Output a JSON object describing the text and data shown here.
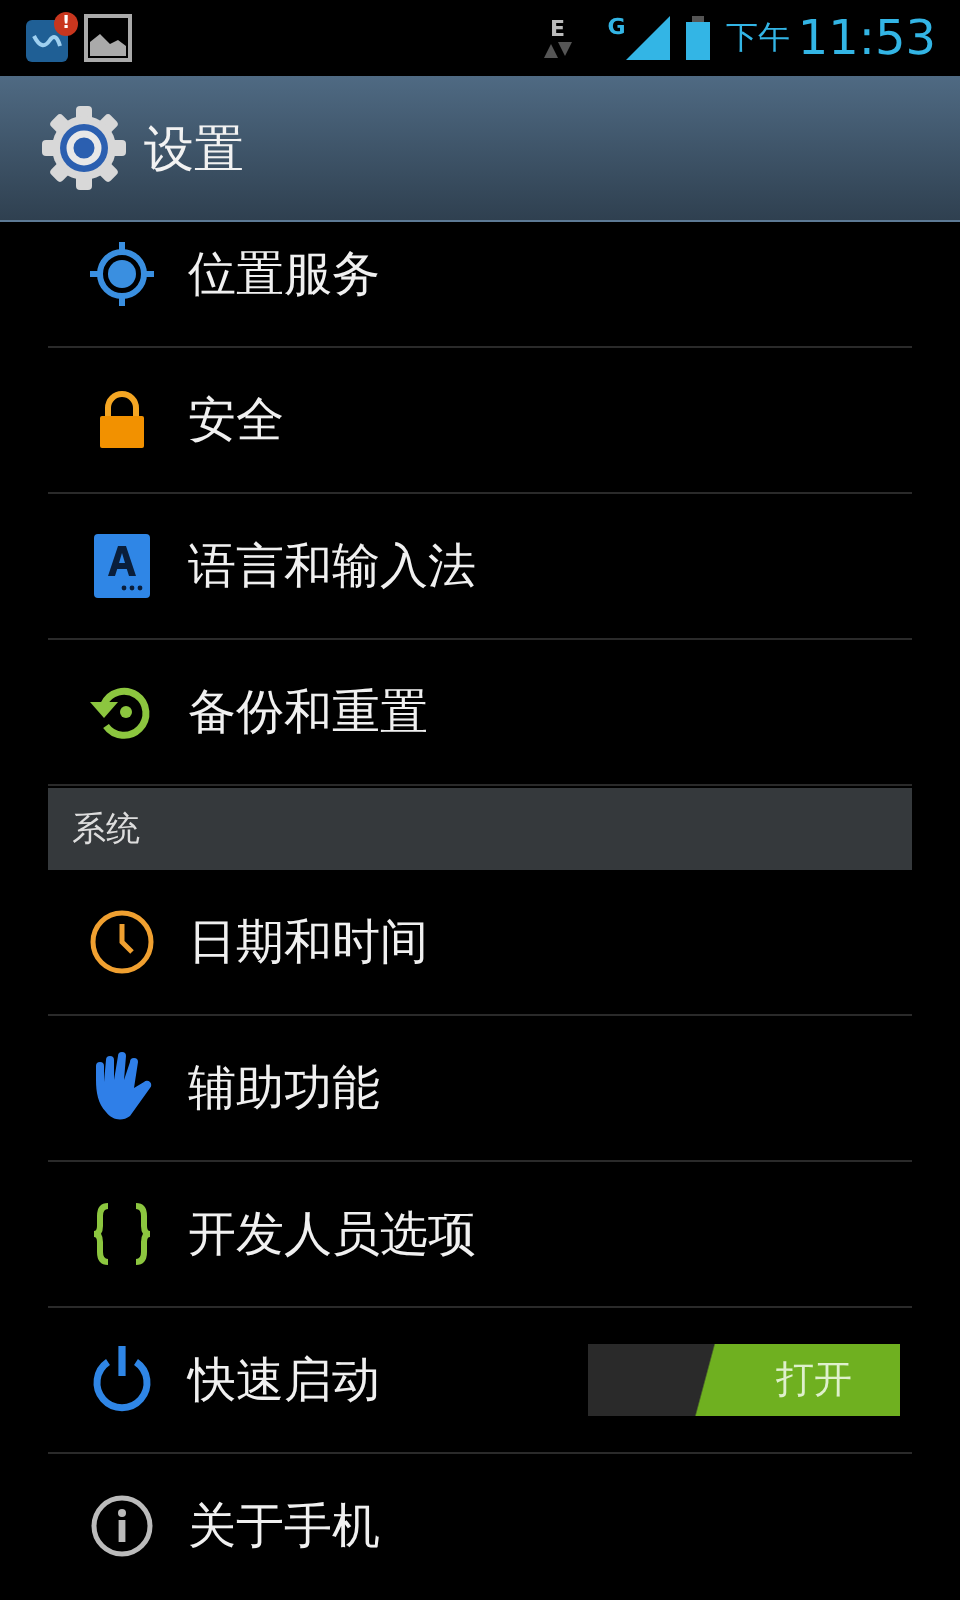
{
  "status_bar": {
    "data_label": "E",
    "network_label": "G",
    "period": "下午",
    "time": "11:53",
    "notification_badge": "!"
  },
  "action_bar": {
    "title": "设置"
  },
  "items": [
    {
      "kind": "setting",
      "label": "位置服务"
    },
    {
      "kind": "setting",
      "label": "安全"
    },
    {
      "kind": "setting",
      "label": "语言和输入法"
    },
    {
      "kind": "setting",
      "label": "备份和重置"
    },
    {
      "kind": "header",
      "label": "系统"
    },
    {
      "kind": "setting",
      "label": "日期和时间"
    },
    {
      "kind": "setting",
      "label": "辅助功能"
    },
    {
      "kind": "setting",
      "label": "开发人员选项"
    },
    {
      "kind": "toggle",
      "label": "快速启动",
      "on": true,
      "switch_label": "打开"
    },
    {
      "kind": "setting",
      "label": "关于手机"
    }
  ]
}
